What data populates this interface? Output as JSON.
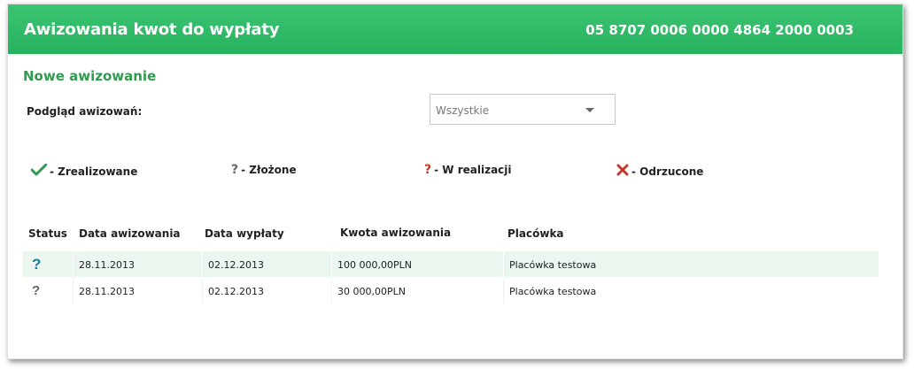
{
  "header": {
    "title": "Awizowania kwot do wypłaty",
    "account": "05 8707 0006 0000 4864 2000 0003"
  },
  "section": {
    "title": "Nowe awizowanie"
  },
  "filter": {
    "label": "Podgląd awizowań:",
    "selected": "Wszystkie"
  },
  "legend": [
    {
      "icon": "check-icon",
      "label": "- Zrealizowane",
      "color": "#2e9b4e"
    },
    {
      "icon": "question-gray-icon",
      "label": "- Złożone",
      "color": "#666666"
    },
    {
      "icon": "question-red-icon",
      "label": "- W realizacji",
      "color": "#c0392b"
    },
    {
      "icon": "cross-icon",
      "label": "- Odrzucone",
      "color": "#c0392b"
    }
  ],
  "table": {
    "columns": [
      "Status",
      "Data awizowania",
      "Data wypłaty",
      "Kwota awizowania",
      "Placówka"
    ],
    "rows": [
      {
        "status_icon": "question-teal-icon",
        "data_awizowania": "28.11.2013",
        "data_wyplaty": "02.12.2013",
        "kwota": "100 000,00",
        "waluta": "PLN",
        "placowka": "Placówka testowa"
      },
      {
        "status_icon": "question-gray-icon",
        "data_awizowania": "28.11.2013",
        "data_wyplaty": "02.12.2013",
        "kwota": "30 000,00",
        "waluta": "PLN",
        "placowka": "Placówka testowa"
      }
    ]
  },
  "colors": {
    "header_green": "#2fba66",
    "title_green": "#2e9b4e",
    "row_highlight": "#eaf6ee",
    "teal_icon": "#1a7f9a"
  }
}
